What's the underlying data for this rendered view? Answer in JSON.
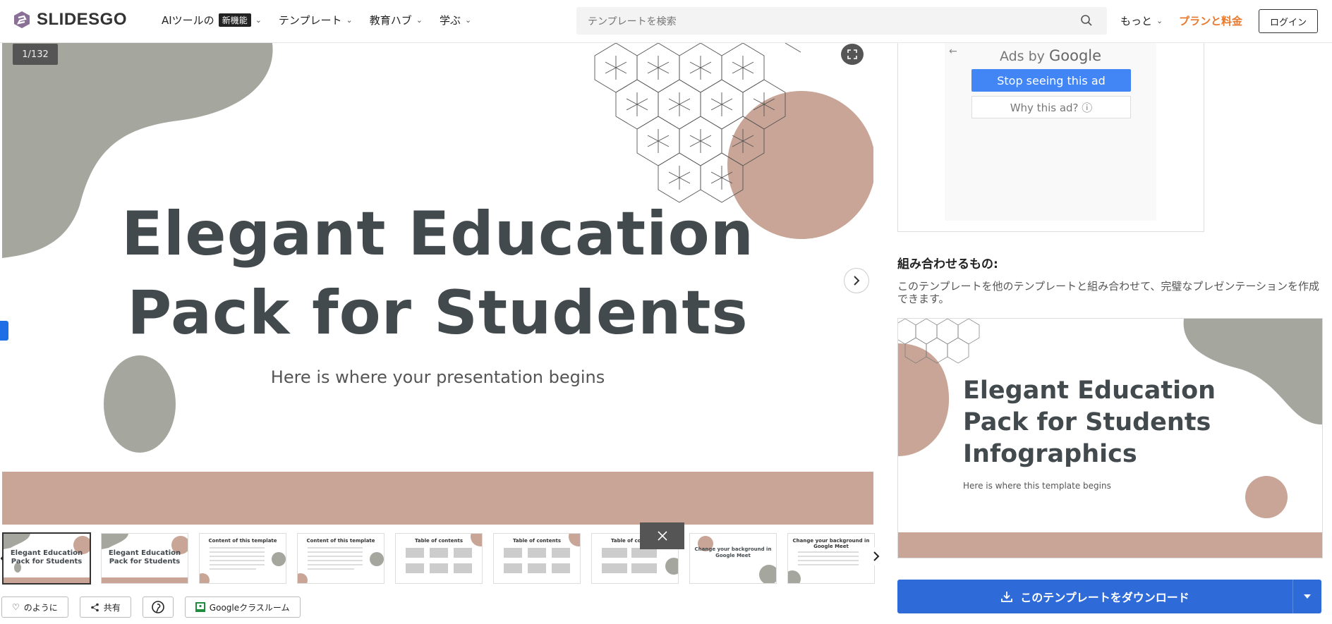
{
  "header": {
    "logo": "SLIDESGO",
    "nav": [
      {
        "label": "AIツールの",
        "badge": "新機能"
      },
      {
        "label": "テンプレート"
      },
      {
        "label": "教育ハブ"
      },
      {
        "label": "学ぶ"
      }
    ],
    "search_placeholder": "テンプレートを検索",
    "more": "もっと",
    "plan": "プランと料金",
    "login": "ログイン"
  },
  "slide": {
    "counter": "1/132",
    "title_line1": "Elegant Education",
    "title_line2": "Pack for Students",
    "subtitle": "Here is where your presentation begins"
  },
  "thumbnails": [
    {
      "label": "",
      "title": "Elegant Education Pack for Students"
    },
    {
      "label": "",
      "title": "Elegant Education Pack for Students"
    },
    {
      "label": "Content of this template",
      "title": ""
    },
    {
      "label": "Content of this template",
      "title": ""
    },
    {
      "label": "Table of contents",
      "title": ""
    },
    {
      "label": "Table of contents",
      "title": ""
    },
    {
      "label": "Table of contents",
      "title": ""
    },
    {
      "label": "",
      "title": "Change your background in Google Meet"
    },
    {
      "label": "Change your background in Google Meet",
      "title": ""
    }
  ],
  "actions": {
    "like": "のように",
    "share": "共有",
    "classroom": "Googleクラスルーム"
  },
  "ad": {
    "ads_by": "Ads by",
    "google": "Google",
    "stop": "Stop seeing this ad",
    "why": "Why this ad? ⓘ"
  },
  "combine": {
    "title": "組み合わせるもの:",
    "description": "このテンプレートを他のテンプレートと組み合わせて、完璧なプレゼンテーションを作成できます。",
    "card_title_1": "Elegant Education",
    "card_title_2": "Pack for Students",
    "card_title_3": "Infographics",
    "card_sub": "Here is where this template begins"
  },
  "download": {
    "label": "このテンプレートをダウンロード"
  },
  "colors": {
    "accent_orange": "#e8792d",
    "download_blue": "#2f6bd8",
    "slide_text": "#434a4e",
    "tan": "#c8a597",
    "grey_blob": "#a5a79f"
  }
}
